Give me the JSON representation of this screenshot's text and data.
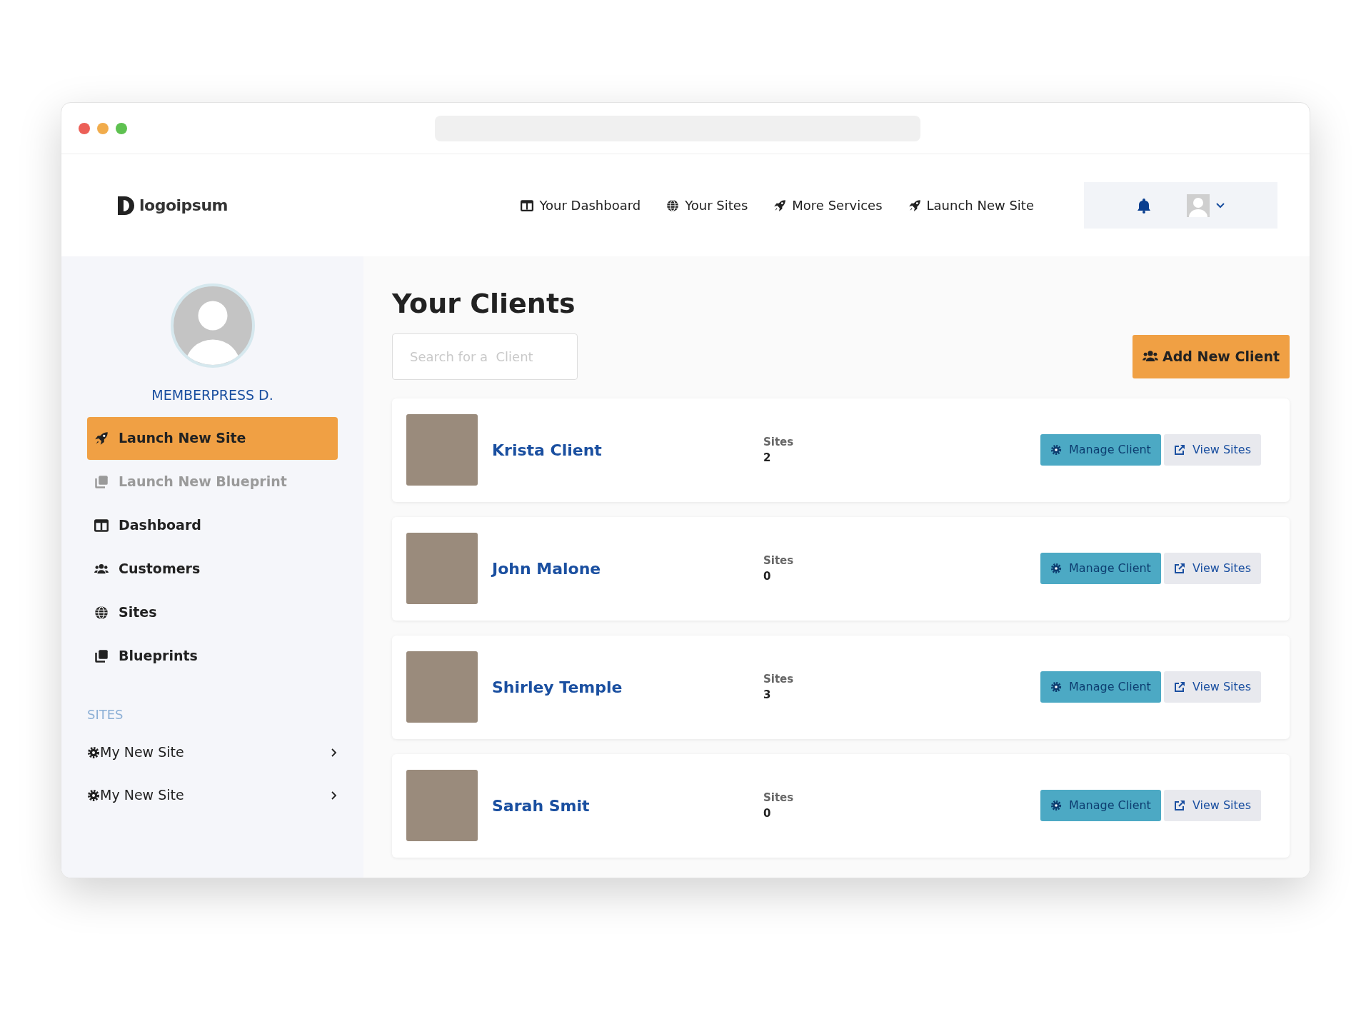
{
  "header": {
    "logo": "logoipsum",
    "nav": [
      {
        "label": "Your Dashboard"
      },
      {
        "label": "Your Sites"
      },
      {
        "label": "More Services"
      },
      {
        "label": "Launch New Site"
      }
    ]
  },
  "sidebar": {
    "profile_name": "MEMBERPRESS D.",
    "items": [
      {
        "label": "Launch New Site",
        "selected": true,
        "disabled": false
      },
      {
        "label": "Launch New Blueprint",
        "selected": false,
        "disabled": true
      },
      {
        "label": "Dashboard",
        "selected": false,
        "disabled": false
      },
      {
        "label": "Customers",
        "selected": false,
        "disabled": false
      },
      {
        "label": "Sites",
        "selected": false,
        "disabled": false
      },
      {
        "label": "Blueprints",
        "selected": false,
        "disabled": false
      }
    ],
    "sites_heading": "SITES",
    "sites": [
      {
        "label": "My New Site"
      },
      {
        "label": "My New Site"
      }
    ]
  },
  "main": {
    "title": "Your Clients",
    "search": {
      "placeholder": "Search for a  Client"
    },
    "add_button": "Add New Client",
    "clients": [
      {
        "name": "Krista Client",
        "sites_label": "Sites",
        "sites_count": "2",
        "manage_button": "Manage Client",
        "view_button": "View Sites"
      },
      {
        "name": "John Malone",
        "sites_label": "Sites",
        "sites_count": "0",
        "manage_button": "Manage Client",
        "view_button": "View Sites"
      },
      {
        "name": "Shirley Temple",
        "sites_label": "Sites",
        "sites_count": "3",
        "manage_button": "Manage Client",
        "view_button": "View Sites"
      },
      {
        "name": "Sarah Smit",
        "sites_label": "Sites",
        "sites_count": "0",
        "manage_button": "Manage Client",
        "view_button": "View Sites"
      }
    ]
  }
}
